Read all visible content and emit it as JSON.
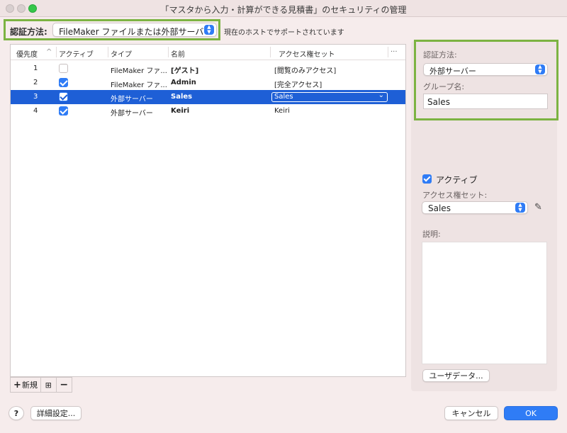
{
  "window": {
    "title": "「マスタから入力・計算ができる見積書」のセキュリティの管理"
  },
  "auth": {
    "label": "認証方法:",
    "selected": "FileMaker ファイルまたは外部サーバー",
    "note": "現在のホストでサポートされています"
  },
  "table": {
    "headers": {
      "priority": "優先度",
      "active": "アクティブ",
      "type": "タイプ",
      "name": "名前",
      "access": "アクセス権セット",
      "more": "···"
    },
    "sort_indicator": "^",
    "rows": [
      {
        "priority": "1",
        "active": false,
        "type": "FileMaker ファ...",
        "name": "[ゲスト]",
        "access": "[閲覧のみアクセス]"
      },
      {
        "priority": "2",
        "active": true,
        "type": "FileMaker ファ...",
        "name": "Admin",
        "access": "[完全アクセス]"
      },
      {
        "priority": "3",
        "active": true,
        "type": "外部サーバー",
        "name": "Sales",
        "access": "Sales"
      },
      {
        "priority": "4",
        "active": true,
        "type": "外部サーバー",
        "name": "Keiri",
        "access": "Keiri"
      }
    ],
    "selected_index": 2,
    "buttons": {
      "new": "新規",
      "duplicate": "⊞",
      "remove": "−"
    }
  },
  "detail": {
    "auth_label": "認証方法:",
    "auth_selected": "外部サーバー",
    "group_label": "グループ名:",
    "group_value": "Sales",
    "active_label": "アクティブ",
    "access_label": "アクセス権セット:",
    "access_selected": "Sales",
    "desc_label": "説明:",
    "userdata_button": "ユーザデータ..."
  },
  "footer": {
    "help": "?",
    "advanced": "詳細設定...",
    "cancel": "キャンセル",
    "ok": "OK"
  },
  "colors": {
    "accent": "#2f7cf6",
    "selection": "#1e5fd6",
    "highlight_border": "#7cb342"
  }
}
